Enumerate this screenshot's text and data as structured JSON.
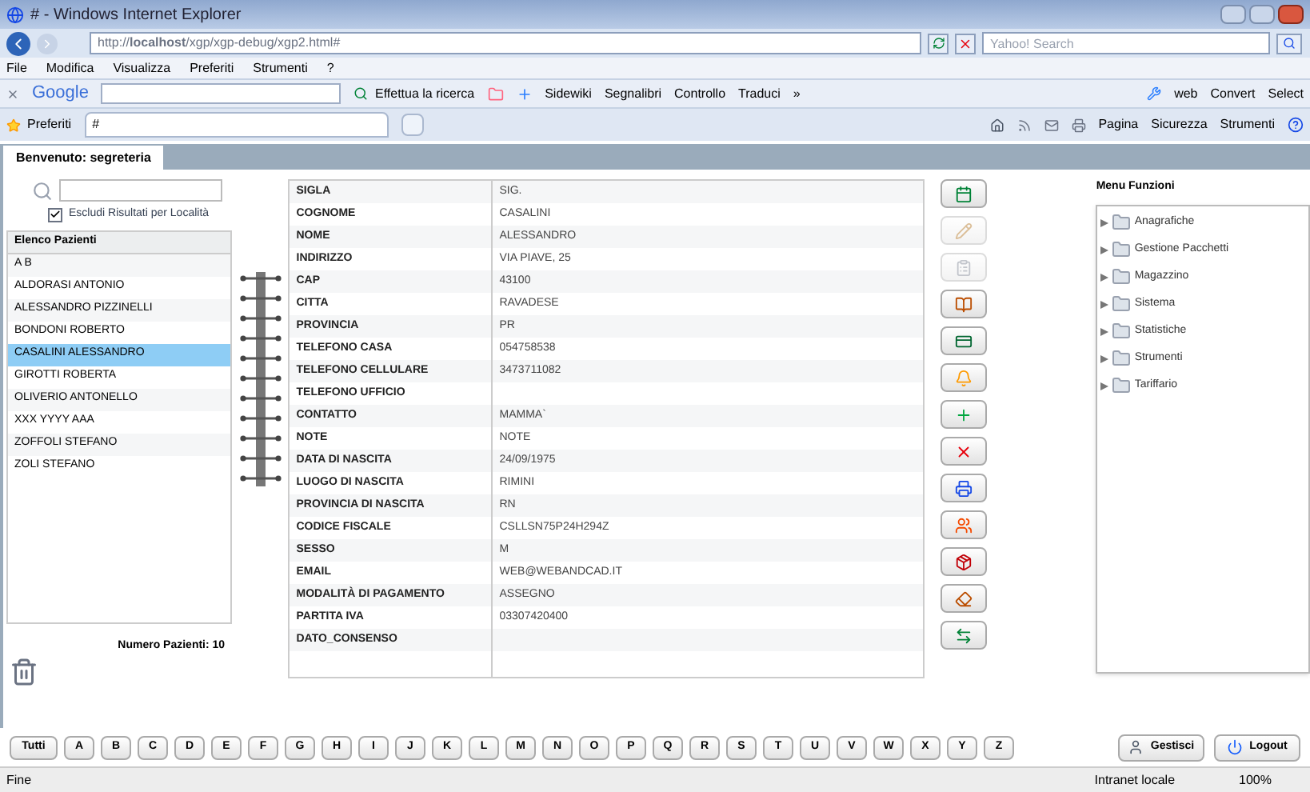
{
  "window": {
    "title": "# - Windows Internet Explorer"
  },
  "address_bar": {
    "url": "http://**localhost**/xgp/xgp-debug/xgp2.html#",
    "search_placeholder": "Yahoo! Search"
  },
  "menu_bar": [
    "File",
    "Modifica",
    "Visualizza",
    "Preferiti",
    "Strumenti",
    "?"
  ],
  "google_toolbar": {
    "logo": "Google",
    "search_button": "Effettua la ricerca",
    "items": [
      "Sidewiki",
      "Segnalibri",
      "Controllo",
      "Traduci",
      "»"
    ],
    "right_items": [
      "web",
      "Convert",
      "Select"
    ]
  },
  "tab_bar": {
    "favorites": "Preferiti",
    "tabs": [
      {
        "label": "#",
        "selected": true
      }
    ]
  },
  "command_bar": [
    "Pagina",
    "Sicurezza",
    "Strumenti"
  ],
  "app_tabs": [
    {
      "label": "Benvenuto: segreteria",
      "selected": true
    }
  ],
  "patient_search": {
    "exclude_checkbox": {
      "label": "Escludi Risultati per Località",
      "checked": true
    }
  },
  "patients": {
    "header": "Elenco Pazienti",
    "count": "Numero Pazienti: 10",
    "rows": [
      {
        "name": "A B",
        "selected": false
      },
      {
        "name": "ALDORASI ANTONIO",
        "selected": false
      },
      {
        "name": "ALESSANDRO PIZZINELLI",
        "selected": false
      },
      {
        "name": "BONDONI ROBERTO",
        "selected": false
      },
      {
        "name": "CASALINI ALESSANDRO",
        "selected": true
      },
      {
        "name": "GIROTTI ROBERTA",
        "selected": false
      },
      {
        "name": "OLIVERIO ANTONELLO",
        "selected": false
      },
      {
        "name": "XXX YYYY AAA",
        "selected": false
      },
      {
        "name": "ZOFFOLI STEFANO",
        "selected": false
      },
      {
        "name": "ZOLI STEFANO",
        "selected": false
      }
    ]
  },
  "details": [
    {
      "label": "SIGLA",
      "value": "SIG."
    },
    {
      "label": "COGNOME",
      "value": "CASALINI"
    },
    {
      "label": "NOME",
      "value": "ALESSANDRO"
    },
    {
      "label": "INDIRIZZO",
      "value": "VIA PIAVE, 25"
    },
    {
      "label": "CAP",
      "value": "43100"
    },
    {
      "label": "CITTA",
      "value": "RAVADESE"
    },
    {
      "label": "PROVINCIA",
      "value": "PR"
    },
    {
      "label": "TELEFONO CASA",
      "value": "054758538"
    },
    {
      "label": "TELEFONO CELLULARE",
      "value": "3473711082"
    },
    {
      "label": "TELEFONO UFFICIO"
    },
    {
      "label": "CONTATTO",
      "value": "MAMMA`"
    },
    {
      "label": "NOTE",
      "value": "NOTE"
    },
    {
      "label": "DATA DI NASCITA",
      "value": "24/09/1975"
    },
    {
      "label": "LUOGO DI NASCITA",
      "value": "RIMINI"
    },
    {
      "label": "PROVINCIA DI NASCITA",
      "value": "RN"
    },
    {
      "label": "CODICE FISCALE",
      "value": "CSLLSN75P24H294Z"
    },
    {
      "label": "SESSO",
      "value": "M"
    },
    {
      "label": "EMAIL",
      "value": "WEB@WEBANDCAD.IT"
    },
    {
      "label": "MODALITÀ DI PAGAMENTO",
      "value": "ASSEGNO"
    },
    {
      "label": "PARTITA IVA",
      "value": "03307420400"
    },
    {
      "label": "DATO_CONSENSO"
    }
  ],
  "tools": [
    {
      "disabled": false
    },
    {
      "disabled": true
    },
    {
      "disabled": true
    },
    {
      "disabled": false
    },
    {
      "disabled": false
    },
    {
      "disabled": false
    },
    {
      "disabled": false
    },
    {
      "disabled": false
    },
    {
      "disabled": false
    },
    {
      "disabled": false
    },
    {
      "disabled": false
    },
    {
      "disabled": false
    },
    {
      "disabled": false
    }
  ],
  "function_menu": {
    "title": "Menu Funzioni",
    "items": [
      {
        "label": "Anagrafiche",
        "expanded": false
      },
      {
        "label": "Gestione Pacchetti",
        "expanded": false
      },
      {
        "label": "Magazzino",
        "expanded": false
      },
      {
        "label": "Sistema",
        "expanded": false
      },
      {
        "label": "Statistiche",
        "expanded": false
      },
      {
        "label": "Strumenti",
        "expanded": false
      },
      {
        "label": "Tariffario",
        "expanded": false
      }
    ]
  },
  "letters": [
    "Tutti",
    "A",
    "B",
    "C",
    "D",
    "E",
    "F",
    "G",
    "H",
    "I",
    "J",
    "K",
    "L",
    "M",
    "N",
    "O",
    "P",
    "Q",
    "R",
    "S",
    "T",
    "U",
    "V",
    "W",
    "X",
    "Y",
    "Z"
  ],
  "actions": [
    "Gestisci",
    "Logout"
  ],
  "status_bar": {
    "text": "Fine",
    "zone": "Intranet locale",
    "zoom": "100%"
  }
}
